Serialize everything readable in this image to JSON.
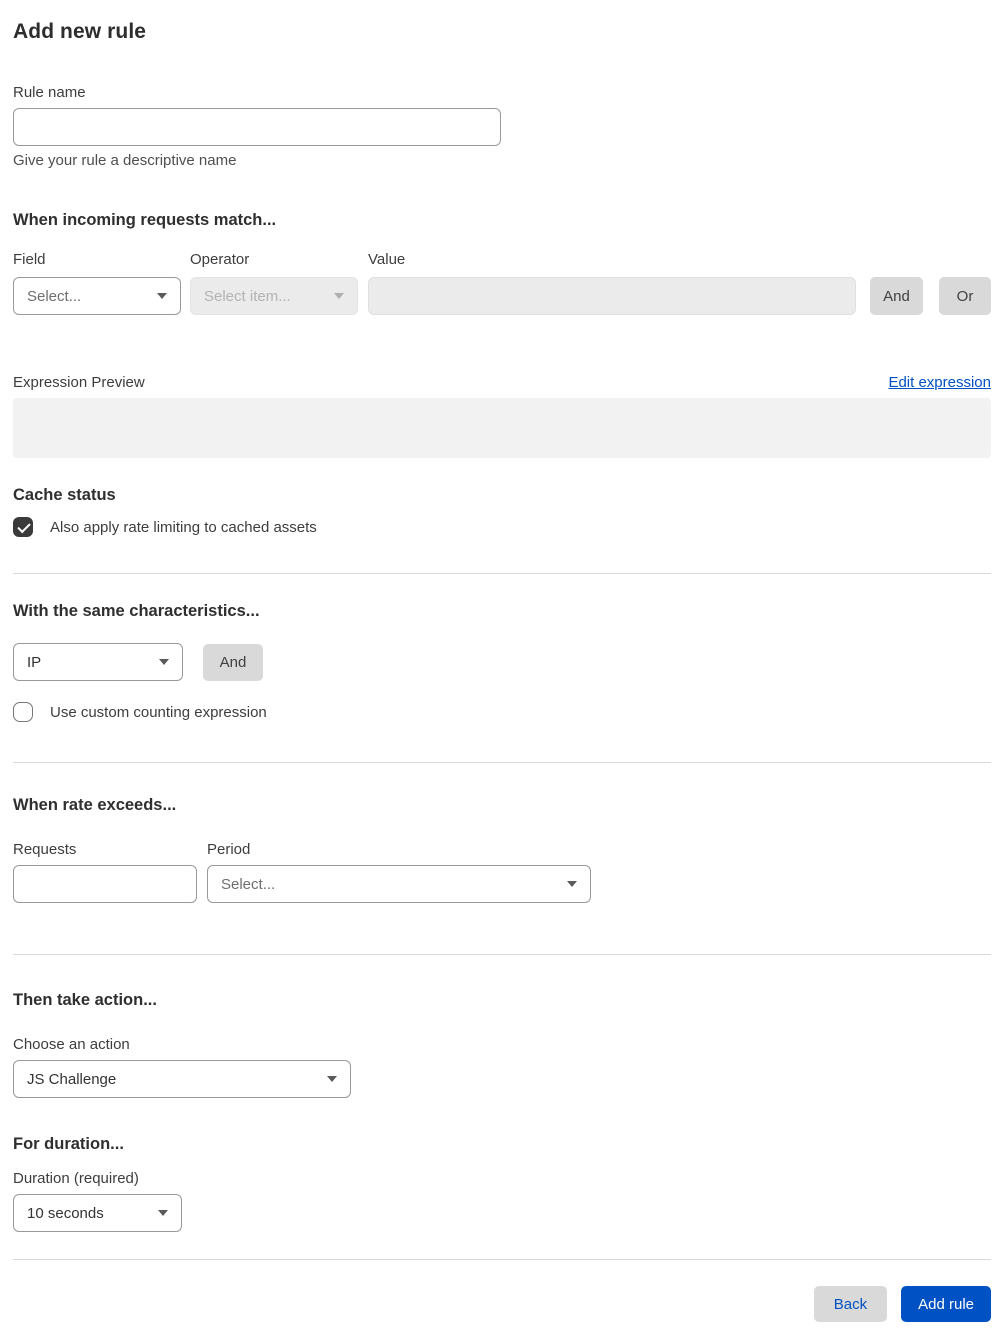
{
  "page": {
    "title": "Add new rule"
  },
  "colors": {
    "accent_blue": "#0051c3",
    "button_gray": "#d9d9d9",
    "disabled_bg": "#ebebeb",
    "preview_bg": "#f2f2f2",
    "divider": "#d9d9d9",
    "checkbox_checked": "#3a3a3a"
  },
  "rule_name": {
    "label": "Rule name",
    "value": "",
    "helper": "Give your rule a descriptive name"
  },
  "match_section": {
    "heading": "When incoming requests match...",
    "field": {
      "label": "Field",
      "selected": "Select..."
    },
    "operator": {
      "label": "Operator",
      "selected": "Select item..."
    },
    "value": {
      "label": "Value",
      "value": ""
    },
    "and_label": "And",
    "or_label": "Or"
  },
  "expression": {
    "label": "Expression Preview",
    "edit_link": "Edit expression",
    "value": ""
  },
  "cache": {
    "heading": "Cache status",
    "checkbox_label": "Also apply rate limiting to cached assets",
    "checked": true
  },
  "characteristics": {
    "heading": "With the same characteristics...",
    "selected": "IP",
    "and_label": "And",
    "checkbox_label": "Use custom counting expression",
    "checked": false
  },
  "rate": {
    "heading": "When rate exceeds...",
    "requests": {
      "label": "Requests",
      "value": ""
    },
    "period": {
      "label": "Period",
      "selected": "Select..."
    }
  },
  "action": {
    "heading": "Then take action...",
    "label": "Choose an action",
    "selected": "JS Challenge"
  },
  "duration": {
    "heading": "For duration...",
    "label": "Duration (required)",
    "selected": "10 seconds"
  },
  "footer": {
    "back_label": "Back",
    "add_label": "Add rule"
  }
}
